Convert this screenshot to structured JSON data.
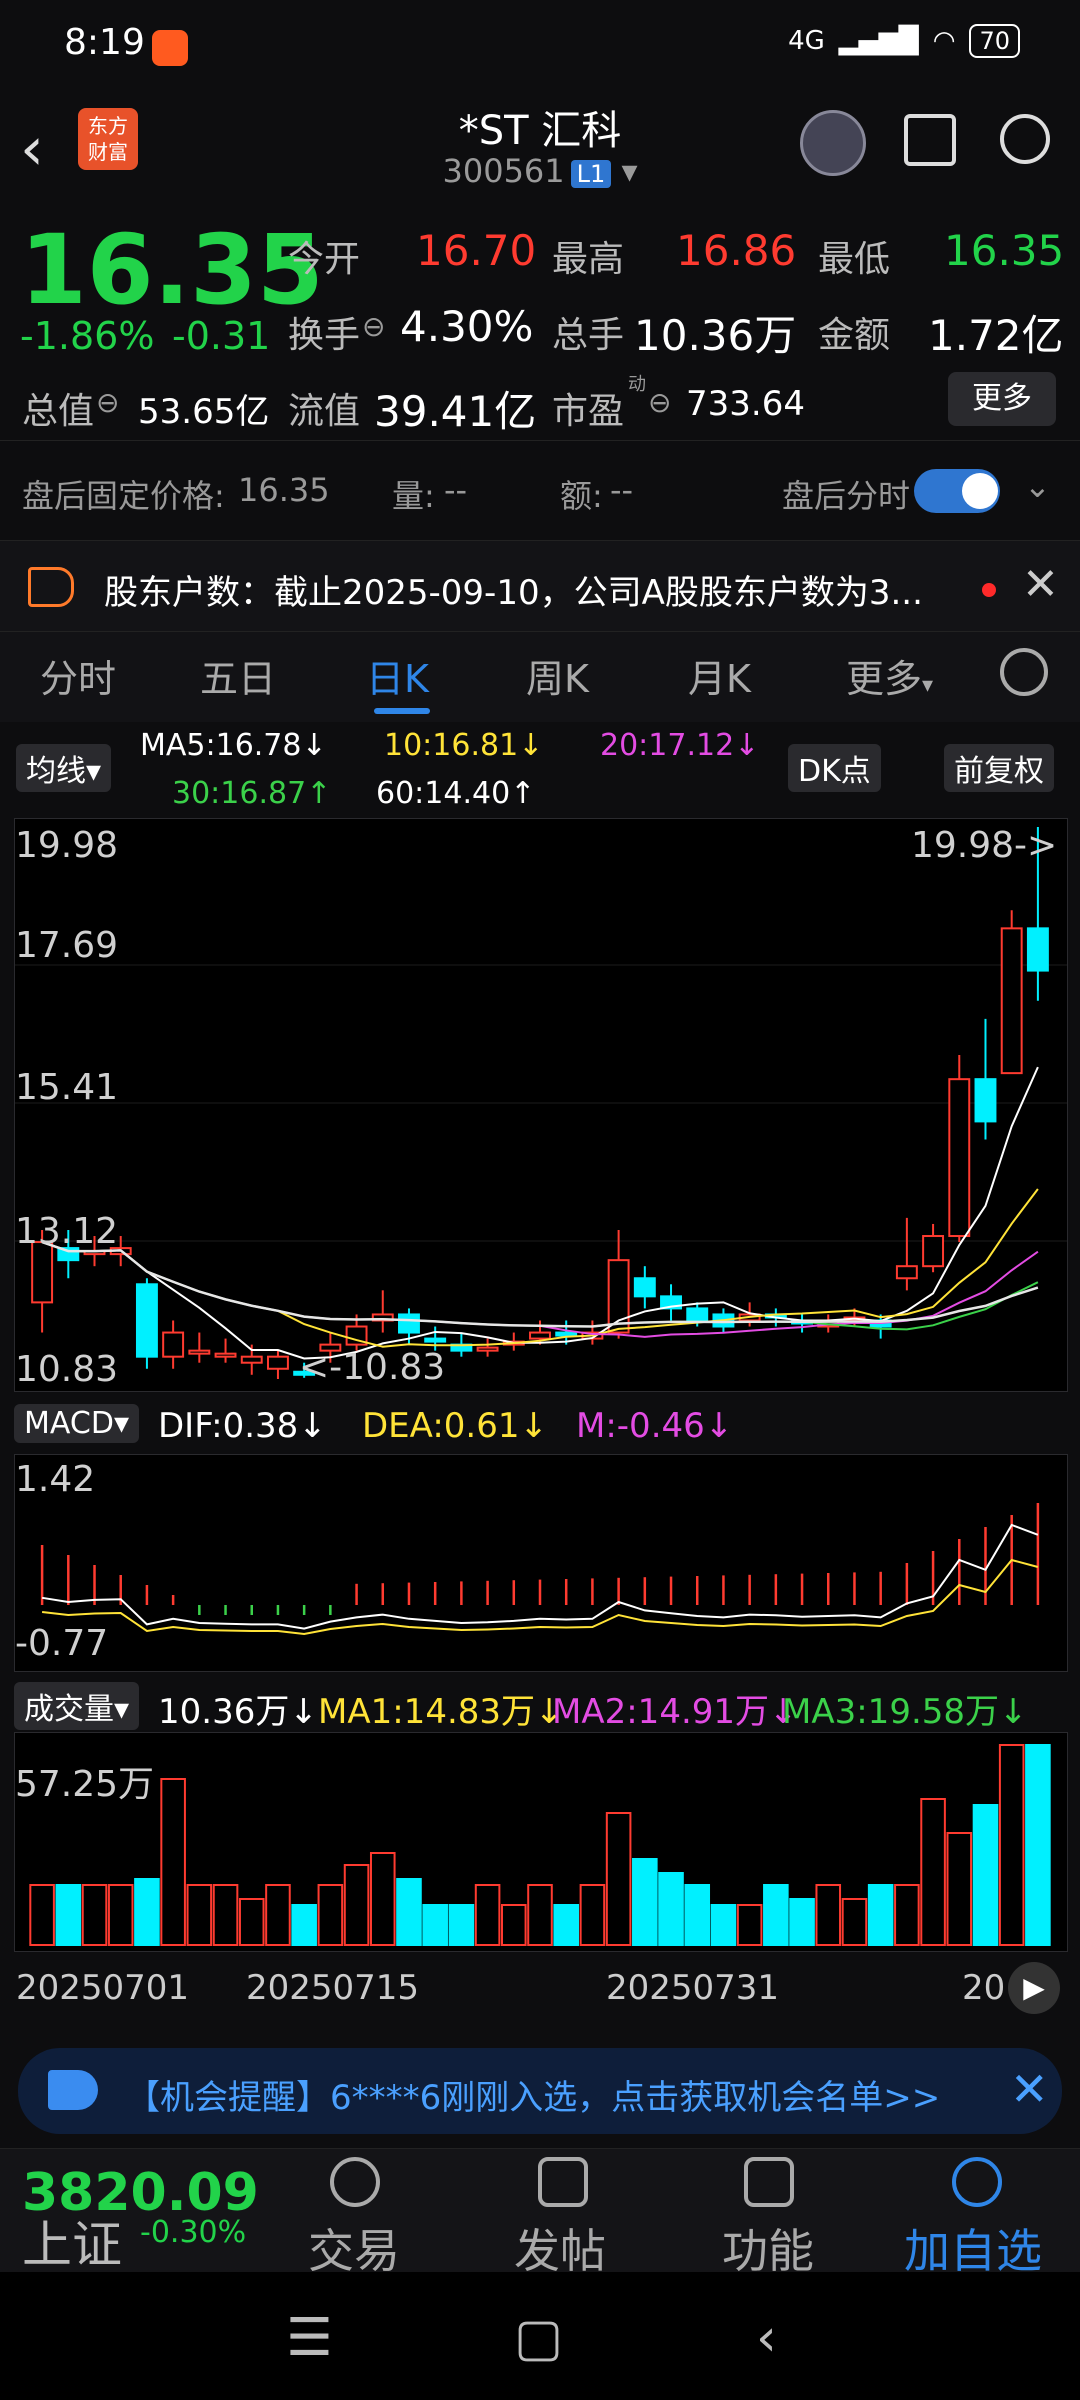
{
  "status_bar": {
    "time": "8:19",
    "network": "4G",
    "battery": "70"
  },
  "header": {
    "logo_line1": "东方",
    "logo_line2": "财富",
    "name": "*ST 汇科",
    "code": "300561",
    "level": "L1"
  },
  "quote": {
    "price": "16.35",
    "change_pct": "-1.86%",
    "change_amt": "-0.31",
    "open_label": "今开",
    "open": "16.70",
    "high_label": "最高",
    "high": "16.86",
    "low_label": "最低",
    "low": "16.35",
    "turnover_label": "换手",
    "turnover": "4.30%",
    "volume_label": "总手",
    "volume": "10.36万",
    "amount_label": "金额",
    "amount": "1.72亿",
    "mktcap_label": "总值",
    "mktcap": "53.65亿",
    "float_label": "流值",
    "float": "39.41亿",
    "pe_label": "市盈",
    "pe_sup": "动",
    "pe": "733.64",
    "more": "更多"
  },
  "after_hours": {
    "price_label": "盘后固定价格:",
    "price": "16.35",
    "vol_label": "量:",
    "vol": "--",
    "amt_label": "额:",
    "amt": "--",
    "toggle_label": "盘后分时"
  },
  "notice": {
    "text": "股东户数：截止2025-09-10，公司A股股东户数为3..."
  },
  "tabs": [
    "分时",
    "五日",
    "日K",
    "周K",
    "月K",
    "更多"
  ],
  "ma_row": {
    "type": "均线",
    "ma5": "MA5:16.78↓",
    "ma10": "10:16.81↓",
    "ma20": "20:17.12↓",
    "ma30": "30:16.87↑",
    "ma60": "60:14.40↑",
    "dk": "DK点",
    "adjust": "前复权"
  },
  "kline": {
    "max_label": "19.98",
    "l2": "17.69",
    "l3": "15.41",
    "l4": "13.12",
    "min_label": "10.83",
    "max_marker": "19.98->",
    "min_marker": "<-10.83"
  },
  "macd": {
    "name": "MACD",
    "dif": "DIF:0.38↓",
    "dea": "DEA:0.61↓",
    "m": "M:-0.46↓",
    "top": "1.42",
    "bottom": "-0.77"
  },
  "volume": {
    "name": "成交量",
    "value": "10.36万↓",
    "ma1": "MA1:14.83万↓",
    "ma2": "MA2:14.91万↓",
    "ma3": "MA3:19.58万↓",
    "top": "57.25万"
  },
  "dates": [
    "20250701",
    "20250715",
    "20250731",
    "20"
  ],
  "promo": {
    "text": "【机会提醒】6****6刚刚入选，点击获取机会名单>>"
  },
  "bottom_nav": {
    "index_value": "3820.09",
    "index_name": "上证",
    "index_change": "-0.30%",
    "trade": "交易",
    "post": "发帖",
    "func": "功能",
    "watch": "加自选"
  },
  "colors": {
    "up": "#ff3b30",
    "down": "#22d34a",
    "accent": "#2f86e8",
    "cyan": "#00f0ff"
  },
  "chart_data": {
    "type": "candlestick",
    "ylim": [
      10.83,
      19.98
    ],
    "candles": [
      {
        "o": 12.1,
        "c": 13.1,
        "h": 13.3,
        "l": 11.6
      },
      {
        "o": 13.0,
        "c": 12.8,
        "h": 13.3,
        "l": 12.5
      },
      {
        "o": 12.9,
        "c": 12.95,
        "h": 13.2,
        "l": 12.7
      },
      {
        "o": 12.9,
        "c": 13.0,
        "h": 13.2,
        "l": 12.7
      },
      {
        "o": 12.4,
        "c": 11.2,
        "h": 12.5,
        "l": 11.0
      },
      {
        "o": 11.2,
        "c": 11.6,
        "h": 11.8,
        "l": 11.0
      },
      {
        "o": 11.3,
        "c": 11.3,
        "h": 11.6,
        "l": 11.1
      },
      {
        "o": 11.2,
        "c": 11.25,
        "h": 11.5,
        "l": 11.1
      },
      {
        "o": 11.1,
        "c": 11.2,
        "h": 11.4,
        "l": 10.9
      },
      {
        "o": 11.0,
        "c": 11.2,
        "h": 11.3,
        "l": 10.83
      },
      {
        "o": 10.95,
        "c": 10.9,
        "h": 11.1,
        "l": 10.85
      },
      {
        "o": 11.3,
        "c": 11.4,
        "h": 11.6,
        "l": 11.1
      },
      {
        "o": 11.4,
        "c": 11.7,
        "h": 11.9,
        "l": 11.3
      },
      {
        "o": 11.8,
        "c": 11.9,
        "h": 12.3,
        "l": 11.6
      },
      {
        "o": 11.9,
        "c": 11.6,
        "h": 12.0,
        "l": 11.4
      },
      {
        "o": 11.5,
        "c": 11.45,
        "h": 11.7,
        "l": 11.3
      },
      {
        "o": 11.4,
        "c": 11.3,
        "h": 11.6,
        "l": 11.2
      },
      {
        "o": 11.3,
        "c": 11.35,
        "h": 11.5,
        "l": 11.2
      },
      {
        "o": 11.4,
        "c": 11.45,
        "h": 11.6,
        "l": 11.3
      },
      {
        "o": 11.5,
        "c": 11.6,
        "h": 11.8,
        "l": 11.4
      },
      {
        "o": 11.6,
        "c": 11.55,
        "h": 11.8,
        "l": 11.4
      },
      {
        "o": 11.5,
        "c": 11.6,
        "h": 11.8,
        "l": 11.4
      },
      {
        "o": 11.6,
        "c": 12.8,
        "h": 13.3,
        "l": 11.5
      },
      {
        "o": 12.5,
        "c": 12.2,
        "h": 12.7,
        "l": 12.0
      },
      {
        "o": 12.2,
        "c": 12.0,
        "h": 12.4,
        "l": 11.8
      },
      {
        "o": 12.0,
        "c": 11.8,
        "h": 12.1,
        "l": 11.7
      },
      {
        "o": 11.9,
        "c": 11.7,
        "h": 12.0,
        "l": 11.6
      },
      {
        "o": 11.8,
        "c": 11.9,
        "h": 12.1,
        "l": 11.7
      },
      {
        "o": 11.9,
        "c": 11.85,
        "h": 12.0,
        "l": 11.7
      },
      {
        "o": 11.8,
        "c": 11.75,
        "h": 11.9,
        "l": 11.6
      },
      {
        "o": 11.7,
        "c": 11.8,
        "h": 11.9,
        "l": 11.6
      },
      {
        "o": 11.8,
        "c": 11.85,
        "h": 12.0,
        "l": 11.7
      },
      {
        "o": 11.8,
        "c": 11.7,
        "h": 11.9,
        "l": 11.5
      },
      {
        "o": 12.5,
        "c": 12.7,
        "h": 13.5,
        "l": 12.3
      },
      {
        "o": 12.7,
        "c": 13.2,
        "h": 13.4,
        "l": 12.6
      },
      {
        "o": 13.2,
        "c": 15.8,
        "h": 16.2,
        "l": 13.1
      },
      {
        "o": 15.8,
        "c": 15.1,
        "h": 16.8,
        "l": 14.8
      },
      {
        "o": 15.9,
        "c": 18.3,
        "h": 18.6,
        "l": 15.9
      },
      {
        "o": 18.3,
        "c": 17.6,
        "h": 19.98,
        "l": 17.1
      }
    ],
    "macd_dif_range": [
      -0.77,
      1.42
    ],
    "volume_max": "57.25万"
  }
}
